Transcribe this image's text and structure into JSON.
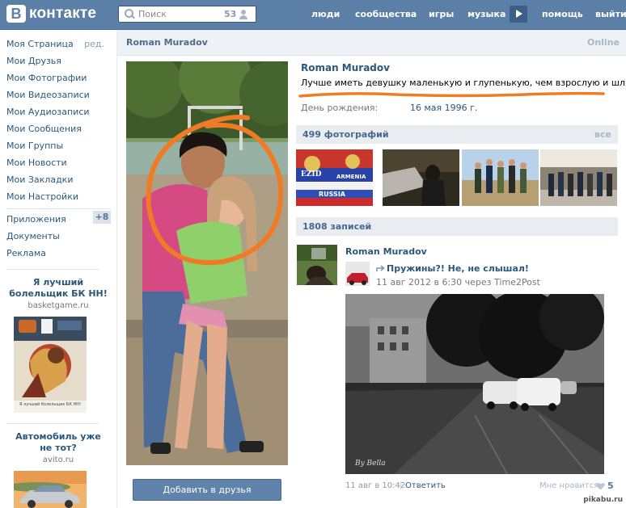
{
  "header": {
    "logo_letter": "В",
    "logo_text": "контакте",
    "search_placeholder": "Поиск",
    "search_count": "53",
    "nav": [
      "люди",
      "сообщества",
      "игры",
      "музыка",
      "помощь",
      "выйти"
    ]
  },
  "sidebar": {
    "items": [
      "Моя Страница",
      "Мои Друзья",
      "Мои Фотографии",
      "Мои Видеозаписи",
      "Мои Аудиозаписи",
      "Мои Сообщения",
      "Мои Группы",
      "Мои Новости",
      "Мои Закладки",
      "Мои Настройки"
    ],
    "edit_label": "ред.",
    "items2": [
      "Приложения",
      "Документы",
      "Реклама"
    ],
    "apps_badge": "+8",
    "ad1": {
      "title_line1": "Я лучший",
      "title_line2": "болельщик БК НН!",
      "domain": "basketgame.ru",
      "image_caption": "Я лучший болельщик БК НН!"
    },
    "ad2": {
      "title_line1": "Автомобиль уже",
      "title_line2": "не тот?",
      "domain": "avito.ru"
    }
  },
  "profile": {
    "name_bar": "Roman Muradov",
    "online": "Online",
    "name": "Roman Muradov",
    "status": "Лучше иметь девушку маленькую и глупенькую, чем взрослую и шлюху",
    "bday_label": "День рождения:",
    "bday_value": "16 мая 1996 г.",
    "add_friend": "Добавить в друзья"
  },
  "photos": {
    "title": "499 фотографий",
    "link": "все",
    "thumb1_text": [
      "EZID",
      "ARMENIA",
      "RUSSIA"
    ]
  },
  "wall": {
    "title": "1808 записей",
    "post": {
      "author": "Roman Muradov",
      "repost_title": "Пружины?! Не, не слышал!",
      "repost_meta": "11 авг 2012 в 6:30 через Time2Post",
      "photo_signature": "By Bella",
      "date": "11 авг в 10:42",
      "separator": "|",
      "reply": "Ответить",
      "likes_label": "Мне нравится",
      "likes_count": "5"
    }
  },
  "colors": {
    "header": "#5b7fa6",
    "link": "#2b587a",
    "annotation": "#f07b26"
  },
  "watermark_text": "pikabu.ru"
}
